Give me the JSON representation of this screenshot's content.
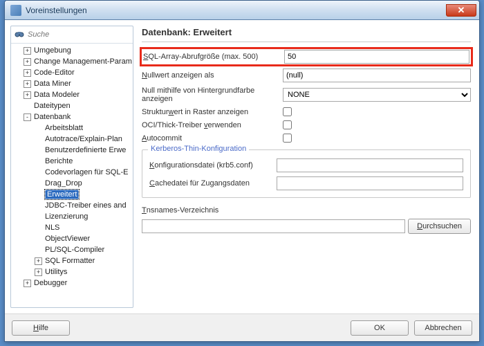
{
  "window": {
    "title": "Voreinstellungen"
  },
  "search": {
    "placeholder": "Suche"
  },
  "tree": {
    "items": [
      {
        "label": "Umgebung",
        "depth": 1,
        "exp": "+"
      },
      {
        "label": "Change Management-Param",
        "depth": 1,
        "exp": "+"
      },
      {
        "label": "Code-Editor",
        "depth": 1,
        "exp": "+"
      },
      {
        "label": "Data Miner",
        "depth": 1,
        "exp": "+"
      },
      {
        "label": "Data Modeler",
        "depth": 1,
        "exp": "+"
      },
      {
        "label": "Dateitypen",
        "depth": 1,
        "exp": ""
      },
      {
        "label": "Datenbank",
        "depth": 1,
        "exp": "-"
      },
      {
        "label": "Arbeitsblatt",
        "depth": 2,
        "exp": ""
      },
      {
        "label": "Autotrace/Explain-Plan",
        "depth": 2,
        "exp": ""
      },
      {
        "label": "Benutzerdefinierte Erwe",
        "depth": 2,
        "exp": ""
      },
      {
        "label": "Berichte",
        "depth": 2,
        "exp": ""
      },
      {
        "label": "Codevorlagen für SQL-E",
        "depth": 2,
        "exp": ""
      },
      {
        "label": "Drag_Drop",
        "depth": 2,
        "exp": ""
      },
      {
        "label": "Erweitert",
        "depth": 2,
        "exp": "",
        "selected": true
      },
      {
        "label": "JDBC-Treiber eines and",
        "depth": 2,
        "exp": ""
      },
      {
        "label": "Lizenzierung",
        "depth": 2,
        "exp": ""
      },
      {
        "label": "NLS",
        "depth": 2,
        "exp": ""
      },
      {
        "label": "ObjectViewer",
        "depth": 2,
        "exp": ""
      },
      {
        "label": "PL/SQL-Compiler",
        "depth": 2,
        "exp": ""
      },
      {
        "label": "SQL Formatter",
        "depth": 2,
        "exp": "+"
      },
      {
        "label": "Utilitys",
        "depth": 2,
        "exp": "+"
      },
      {
        "label": "Debugger",
        "depth": 1,
        "exp": "+"
      }
    ]
  },
  "page": {
    "title": "Datenbank: Erweitert",
    "sql_array_label": "SQL-Array-Abrufgröße (max. 500)",
    "sql_array_value": "50",
    "null_display_label": "Nullwert anzeigen als",
    "null_display_value": "(null)",
    "null_bg_label": "Null mithilfe von Hintergrundfarbe anzeigen",
    "null_bg_value": "NONE",
    "struct_label": "Strukturwert in Raster anzeigen",
    "struct_checked": false,
    "oci_label": "OCI/Thick-Treiber verwenden",
    "oci_checked": false,
    "autocommit_label": "Autocommit",
    "autocommit_checked": false,
    "kerberos_title": "Kerberos-Thin-Konfiguration",
    "krb_conf_label": "Konfigurationsdatei (krb5.conf)",
    "krb_conf_value": "",
    "krb_cache_label": "Cachedatei für Zugangsdaten",
    "krb_cache_value": "",
    "tns_label": "Tnsnames-Verzeichnis",
    "tns_value": "",
    "browse_label": "Durchsuchen"
  },
  "footer": {
    "help": "Hilfe",
    "ok": "OK",
    "cancel": "Abbrechen"
  }
}
